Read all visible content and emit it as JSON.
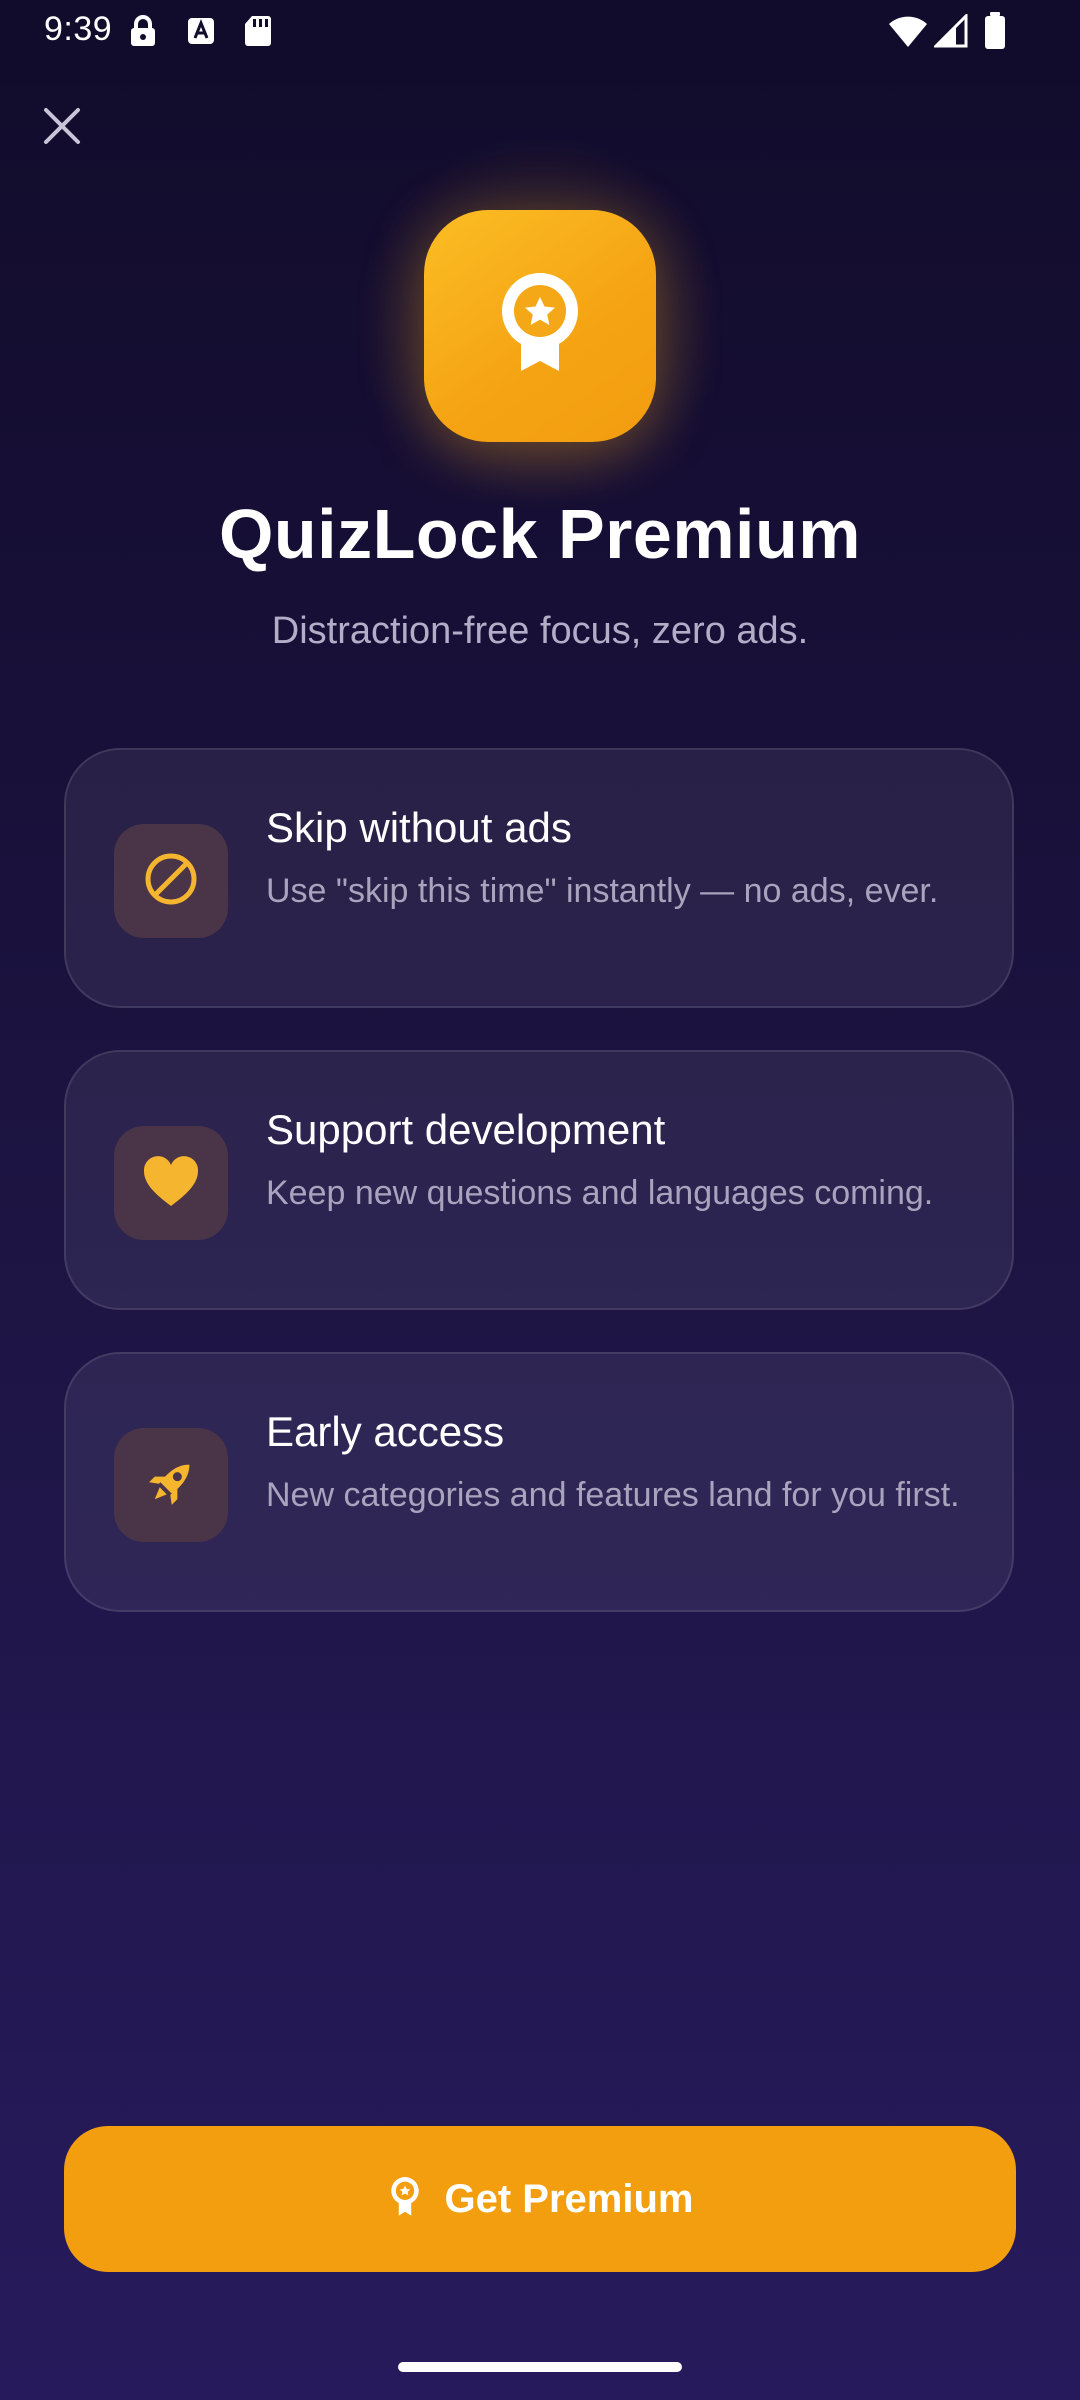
{
  "status_bar": {
    "time": "9:39",
    "left_icons": [
      "lock-icon",
      "keyboard-icon",
      "sd-card-icon"
    ],
    "right_icons": [
      "wifi-icon",
      "cell-signal-icon",
      "battery-icon"
    ]
  },
  "close_button": {
    "icon": "close-icon"
  },
  "hero": {
    "icon": "award-badge-icon",
    "title": "QuizLock Premium",
    "subtitle": "Distraction-free focus, zero ads."
  },
  "features": [
    {
      "icon": "block-icon",
      "title": "Skip without ads",
      "description": "Use \"skip this time\" instantly — no ads, ever."
    },
    {
      "icon": "heart-icon",
      "title": "Support development",
      "description": "Keep new questions and languages coming."
    },
    {
      "icon": "rocket-icon",
      "title": "Early access",
      "description": "New categories and features land for you first."
    }
  ],
  "cta": {
    "icon": "award-badge-icon",
    "label": "Get Premium"
  },
  "colors": {
    "accent": "#F29E0E",
    "background_top": "#110C2B",
    "background_bottom": "#271A5C",
    "icon_box": "#4A3448",
    "feature_icon": "#F5B52E"
  }
}
